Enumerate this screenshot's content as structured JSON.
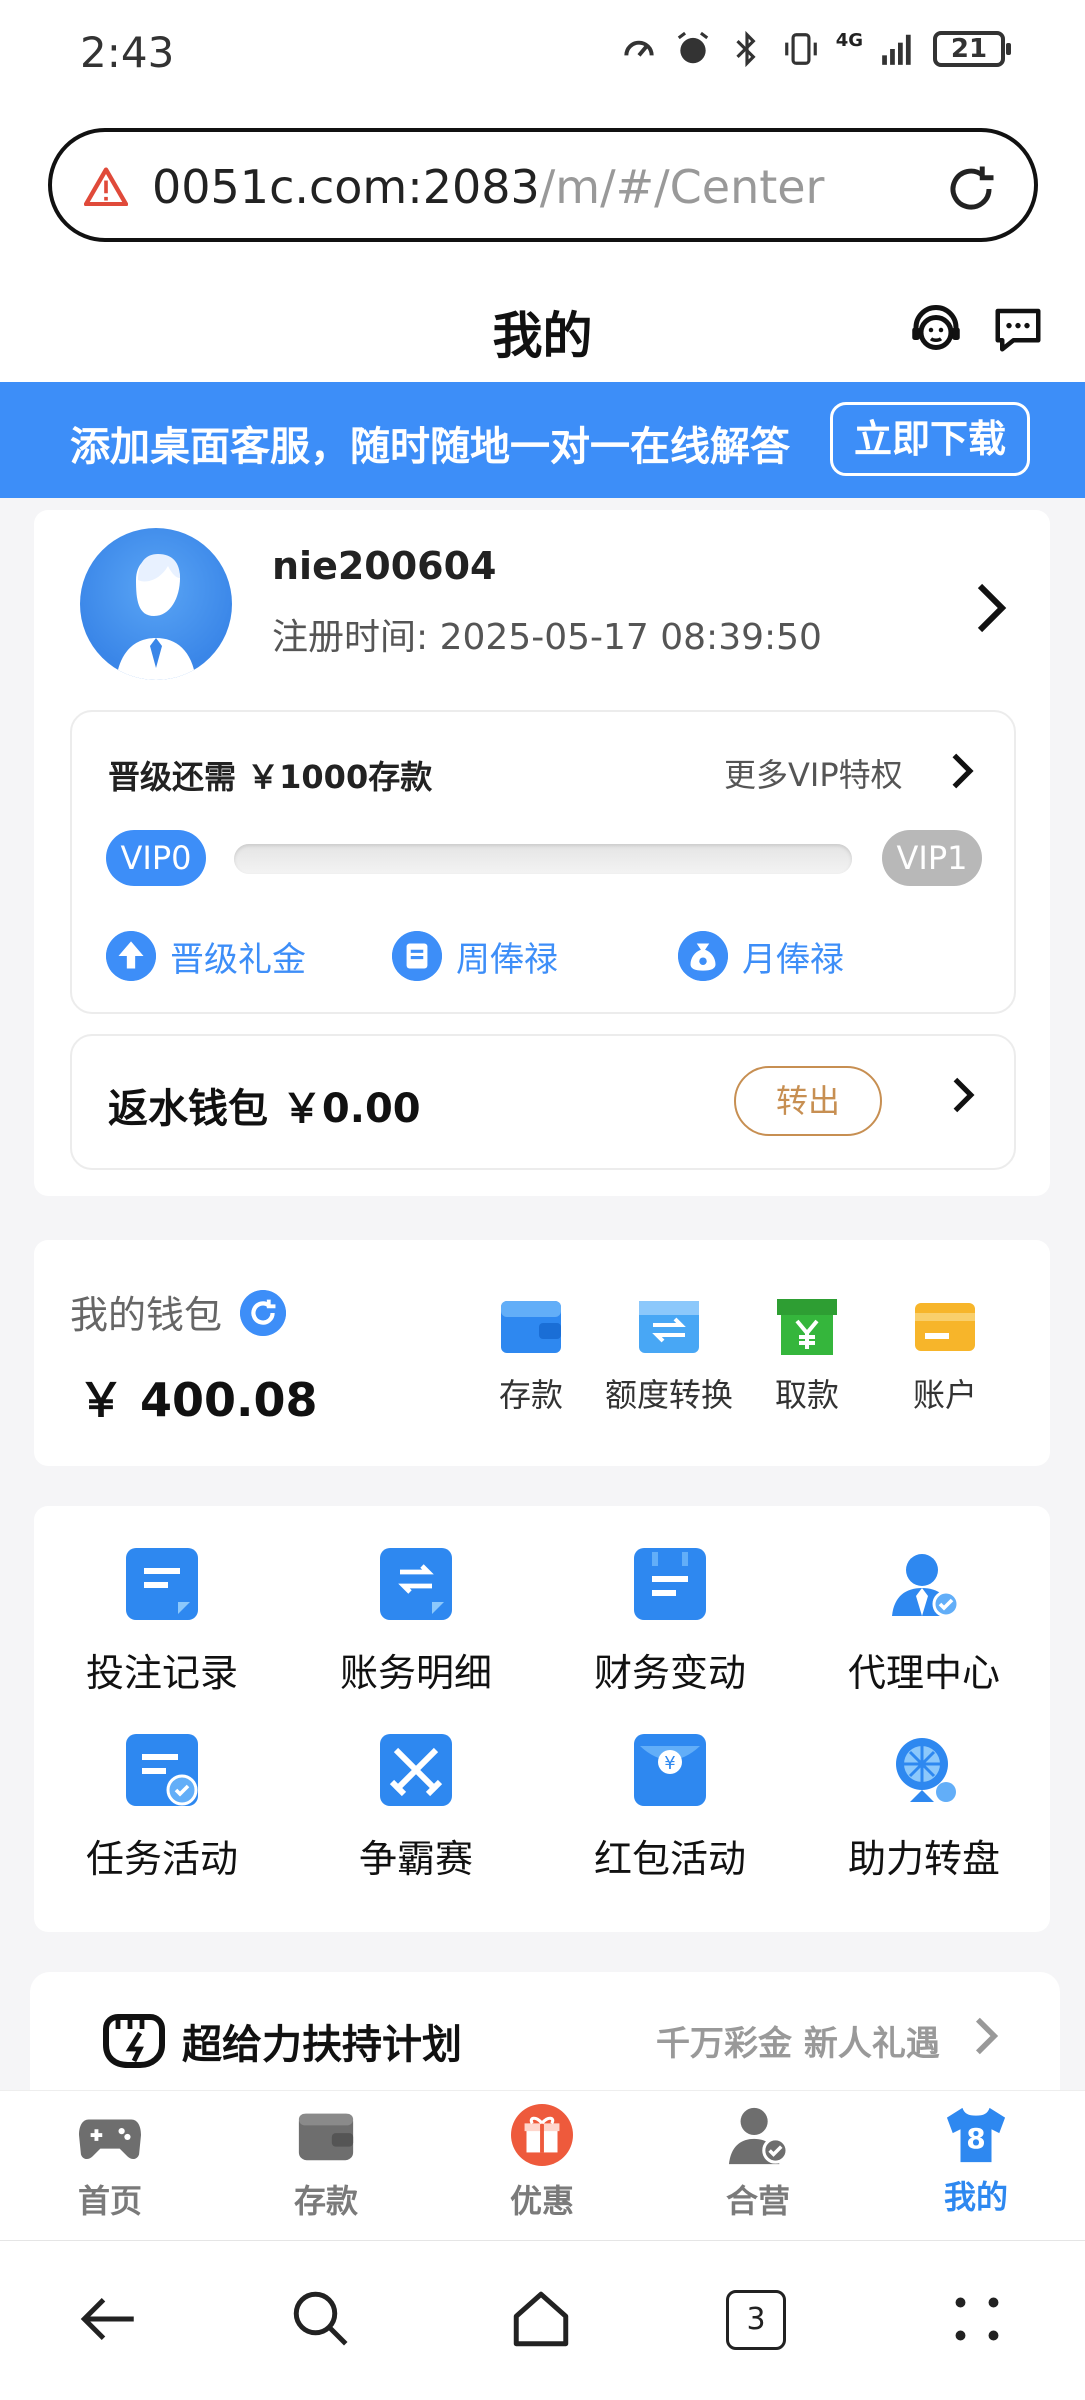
{
  "status_bar": {
    "time": "2:43",
    "battery": "21",
    "network": "4G"
  },
  "browser": {
    "url_host": "0051c.com:2083",
    "url_path": "/m/#/Center"
  },
  "header": {
    "title": "我的"
  },
  "banner": {
    "text": "添加桌面客服，随时随地一对一在线解答",
    "button": "立即下载"
  },
  "user": {
    "username": "nie200604",
    "reg_label": "注册时间:",
    "reg_time": "2025-05-17 08:39:50"
  },
  "vip": {
    "need_text": "晋级还需 ￥1000存款",
    "more_text": "更多VIP特权",
    "current_level": "VIP0",
    "next_level": "VIP1",
    "progress": 0,
    "perks": [
      "晋级礼金",
      "周俸禄",
      "月俸禄"
    ]
  },
  "rebate": {
    "label": "返水钱包 ￥0.00",
    "button": "转出"
  },
  "wallet": {
    "title": "我的钱包",
    "amount": "￥ 400.08",
    "actions": [
      {
        "label": "存款",
        "icon": "deposit-icon",
        "color": "#2e88f0"
      },
      {
        "label": "额度转换",
        "icon": "transfer-icon",
        "color": "#48a7f5"
      },
      {
        "label": "取款",
        "icon": "withdraw-icon",
        "color": "#35b63c"
      },
      {
        "label": "账户",
        "icon": "card-icon",
        "color": "#f7b52a"
      }
    ]
  },
  "menu": {
    "items": [
      {
        "label": "投注记录",
        "icon": "bet-record-icon"
      },
      {
        "label": "账务明细",
        "icon": "ledger-icon"
      },
      {
        "label": "财务变动",
        "icon": "finance-change-icon"
      },
      {
        "label": "代理中心",
        "icon": "agent-icon"
      },
      {
        "label": "任务活动",
        "icon": "task-icon"
      },
      {
        "label": "争霸赛",
        "icon": "swords-icon"
      },
      {
        "label": "红包活动",
        "icon": "red-packet-icon"
      },
      {
        "label": "助力转盘",
        "icon": "wheel-icon"
      }
    ]
  },
  "support_plan": {
    "title": "超给力扶持计划",
    "subtitle": "千万彩金 新人礼遇"
  },
  "tabs": [
    {
      "label": "首页",
      "icon": "gamepad-icon",
      "active": false
    },
    {
      "label": "存款",
      "icon": "wallet-icon",
      "active": false
    },
    {
      "label": "优惠",
      "icon": "gift-icon",
      "active": false
    },
    {
      "label": "合营",
      "icon": "partner-icon",
      "active": false
    },
    {
      "label": "我的",
      "icon": "jersey-icon",
      "active": true,
      "badge": "8"
    }
  ],
  "system_nav": {
    "tabs_count": "3"
  },
  "colors": {
    "accent": "#3d8ef8",
    "rebate_button": "#c78f52",
    "background": "#f5f5f7"
  }
}
